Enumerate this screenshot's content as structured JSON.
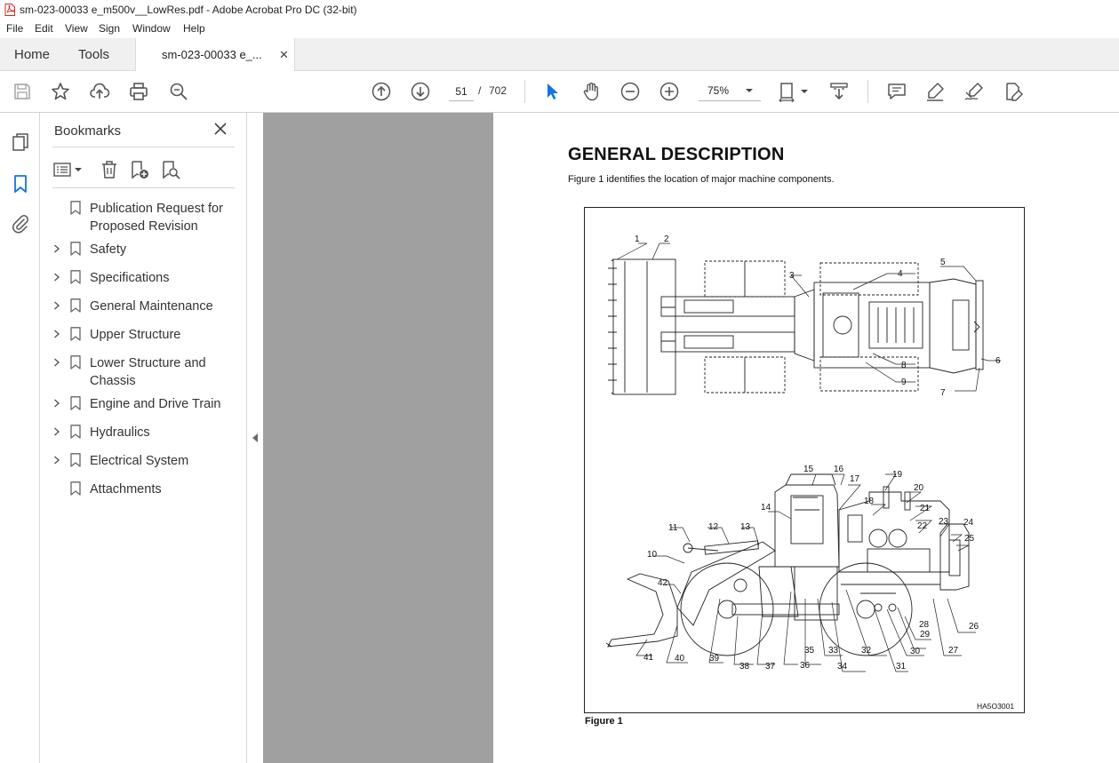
{
  "window": {
    "title": "sm-023-00033 e_m500v__LowRes.pdf - Adobe Acrobat Pro DC (32-bit)"
  },
  "menu": [
    "File",
    "Edit",
    "View",
    "Sign",
    "Window",
    "Help"
  ],
  "tabs": {
    "home": "Home",
    "tools": "Tools",
    "document": "sm-023-00033 e_..."
  },
  "toolbar": {
    "current_page": "51",
    "page_separator": "/",
    "total_pages": "702",
    "zoom": "75%"
  },
  "bookmarks": {
    "title": "Bookmarks",
    "items": [
      {
        "label": "Publication Request for Proposed Revision",
        "expandable": false
      },
      {
        "label": "Safety",
        "expandable": true
      },
      {
        "label": "Specifications",
        "expandable": true
      },
      {
        "label": "General Maintenance",
        "expandable": true
      },
      {
        "label": "Upper Structure",
        "expandable": true
      },
      {
        "label": "Lower Structure and Chassis",
        "expandable": true
      },
      {
        "label": "Engine and Drive Train",
        "expandable": true
      },
      {
        "label": "Hydraulics",
        "expandable": true
      },
      {
        "label": "Electrical System",
        "expandable": true
      },
      {
        "label": "Attachments",
        "expandable": false
      }
    ]
  },
  "document": {
    "heading": "GENERAL DESCRIPTION",
    "intro": "Figure 1 identifies the location of major machine components.",
    "figure_caption": "Figure 1",
    "figure_code": "HA5O3001",
    "callouts": [
      "1",
      "2",
      "3",
      "4",
      "5",
      "6",
      "7",
      "8",
      "9",
      "10",
      "11",
      "12",
      "13",
      "14",
      "15",
      "16",
      "17",
      "18",
      "19",
      "20",
      "21",
      "22",
      "23",
      "24",
      "25",
      "26",
      "27",
      "28",
      "29",
      "30",
      "31",
      "32",
      "33",
      "34",
      "35",
      "36",
      "37",
      "38",
      "39",
      "40",
      "41",
      "42"
    ]
  },
  "colors": {
    "accent": "#1473e6",
    "canvas_gray": "#a0a0a0",
    "tab_bar": "#f0f0f0"
  }
}
